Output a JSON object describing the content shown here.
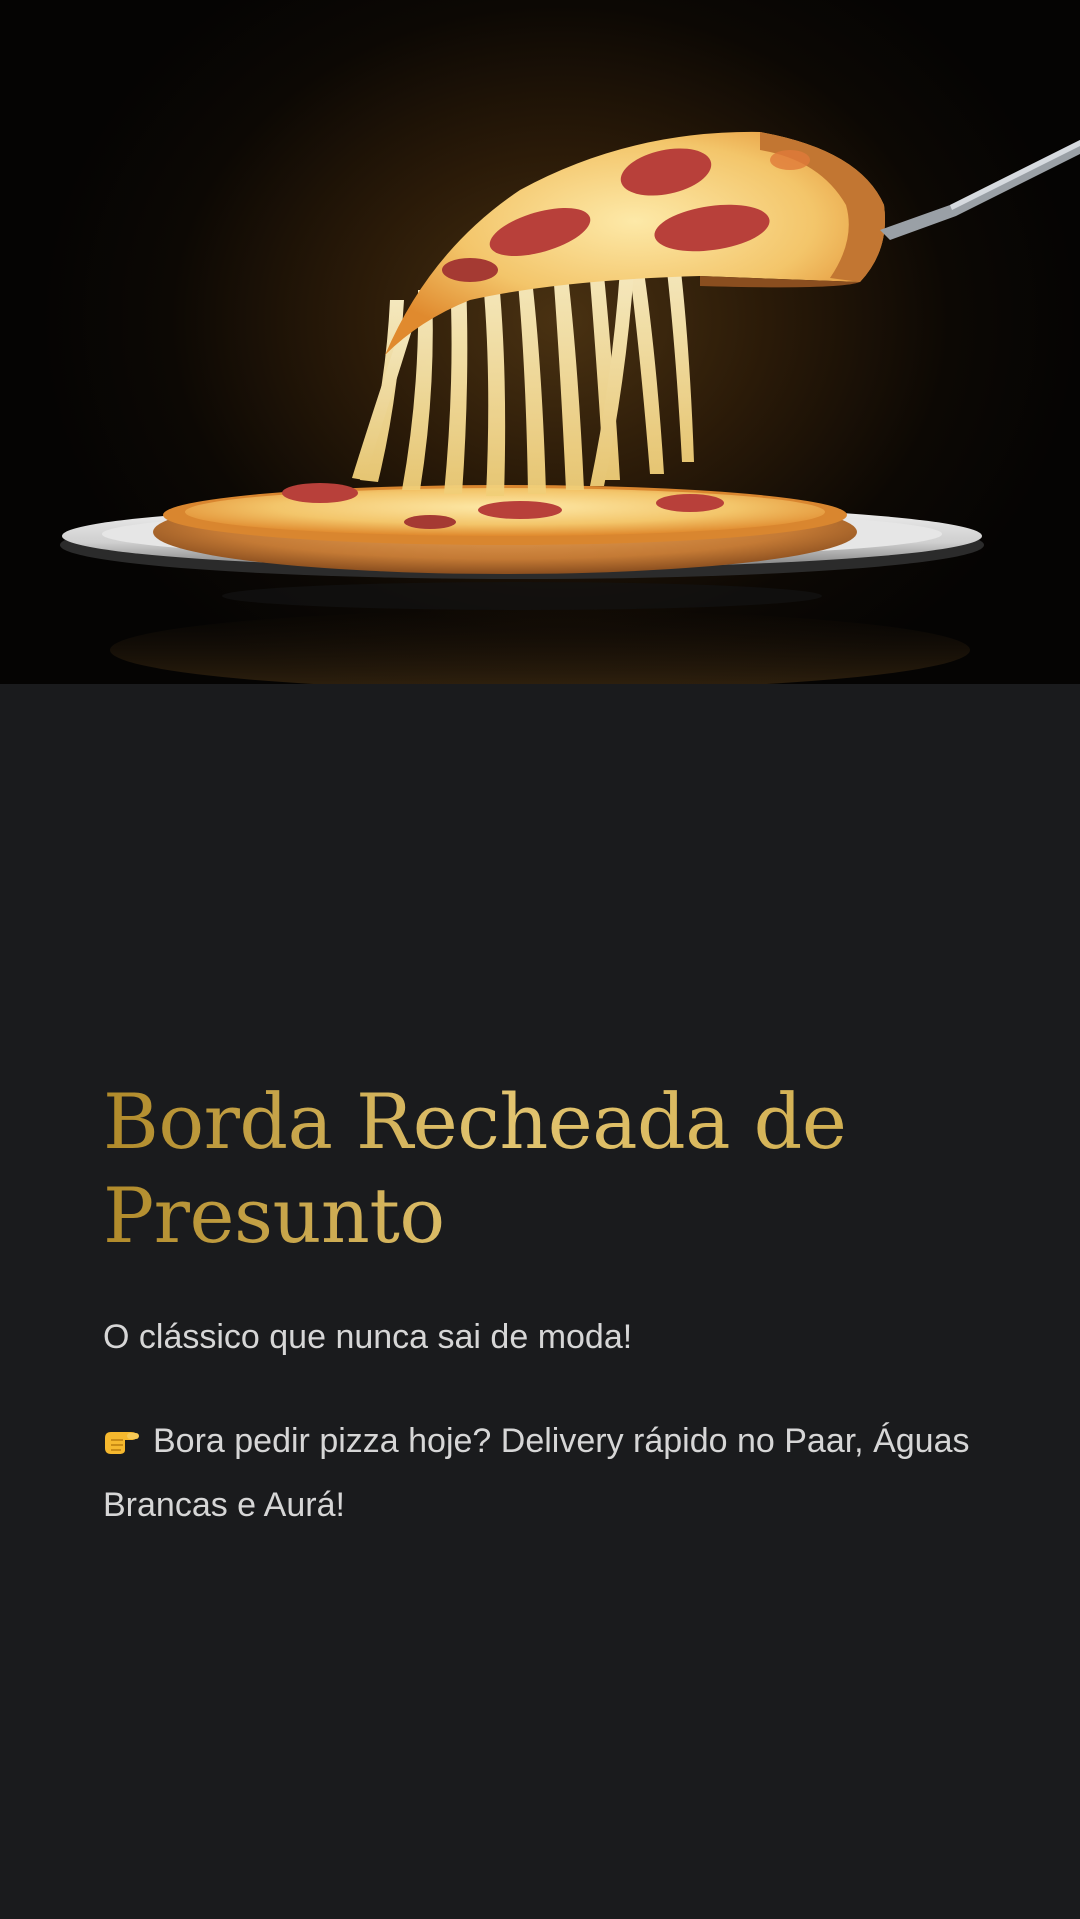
{
  "hero": {
    "image_name": "pizza-cheese-pull-image"
  },
  "post": {
    "title": "Borda Recheada de Presunto",
    "subtitle": "O clássico que nunca sai de moda!",
    "cta_icon": "pointing-right-hand-icon",
    "cta_text": "Bora pedir pizza hoje? Delivery rápido no Paar, Águas Brancas e Aurá!"
  },
  "colors": {
    "background": "#1a1b1d",
    "title_gold": "#d9b85d",
    "body_text": "#d6d6d6"
  }
}
